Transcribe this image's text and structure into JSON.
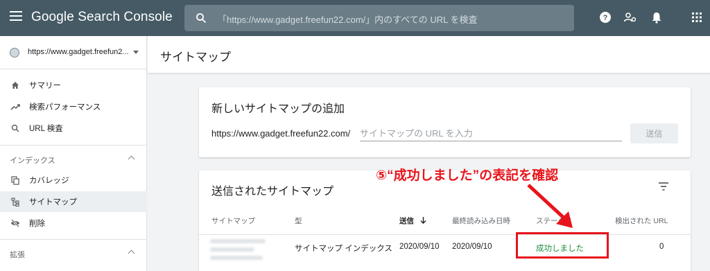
{
  "app": {
    "title": "Google Search Console",
    "search_placeholder": "「https://www.gadget.freefun22.com/」内のすべての URL を検査"
  },
  "topbar_icons": [
    "menu-icon",
    "search-icon",
    "help-icon",
    "manage-users-icon",
    "notifications-icon",
    "apps-grid-icon"
  ],
  "sidebar": {
    "property": "https://www.gadget.freefun2...",
    "items": [
      {
        "label": "サマリー",
        "icon": "home-icon"
      },
      {
        "label": "検索パフォーマンス",
        "icon": "trending-up-icon"
      },
      {
        "label": "URL 検査",
        "icon": "search-icon"
      }
    ],
    "index_section": {
      "label": "インデックス",
      "items": [
        {
          "label": "カバレッジ",
          "icon": "copy-icon"
        },
        {
          "label": "サイトマップ",
          "icon": "sitemap-icon"
        },
        {
          "label": "削除",
          "icon": "visibility-off-icon"
        }
      ]
    },
    "enhancements_section": {
      "label": "拡張"
    }
  },
  "page": {
    "title": "サイトマップ"
  },
  "add_card": {
    "title": "新しいサイトマップの追加",
    "base_url": "https://www.gadget.freefun22.com/",
    "input_placeholder": "サイトマップの URL を入力",
    "submit_label": "送信"
  },
  "list_card": {
    "title": "送信されたサイトマップ",
    "columns": [
      "サイトマップ",
      "型",
      "送信",
      "最終読み込み日時",
      "ステータス",
      "検出された URL"
    ],
    "rows": [
      {
        "sitemap": "",
        "type": "サイトマップ インデックス",
        "submitted": "2020/09/10",
        "last_read": "2020/09/10",
        "status": "成功しました",
        "discovered": "0"
      }
    ]
  },
  "annotation": {
    "text": "⑤“成功しました”の表記を確認"
  },
  "colors": {
    "topbar": "#455a64",
    "success": "#1e8e3e",
    "annotation": "#e8141b"
  }
}
